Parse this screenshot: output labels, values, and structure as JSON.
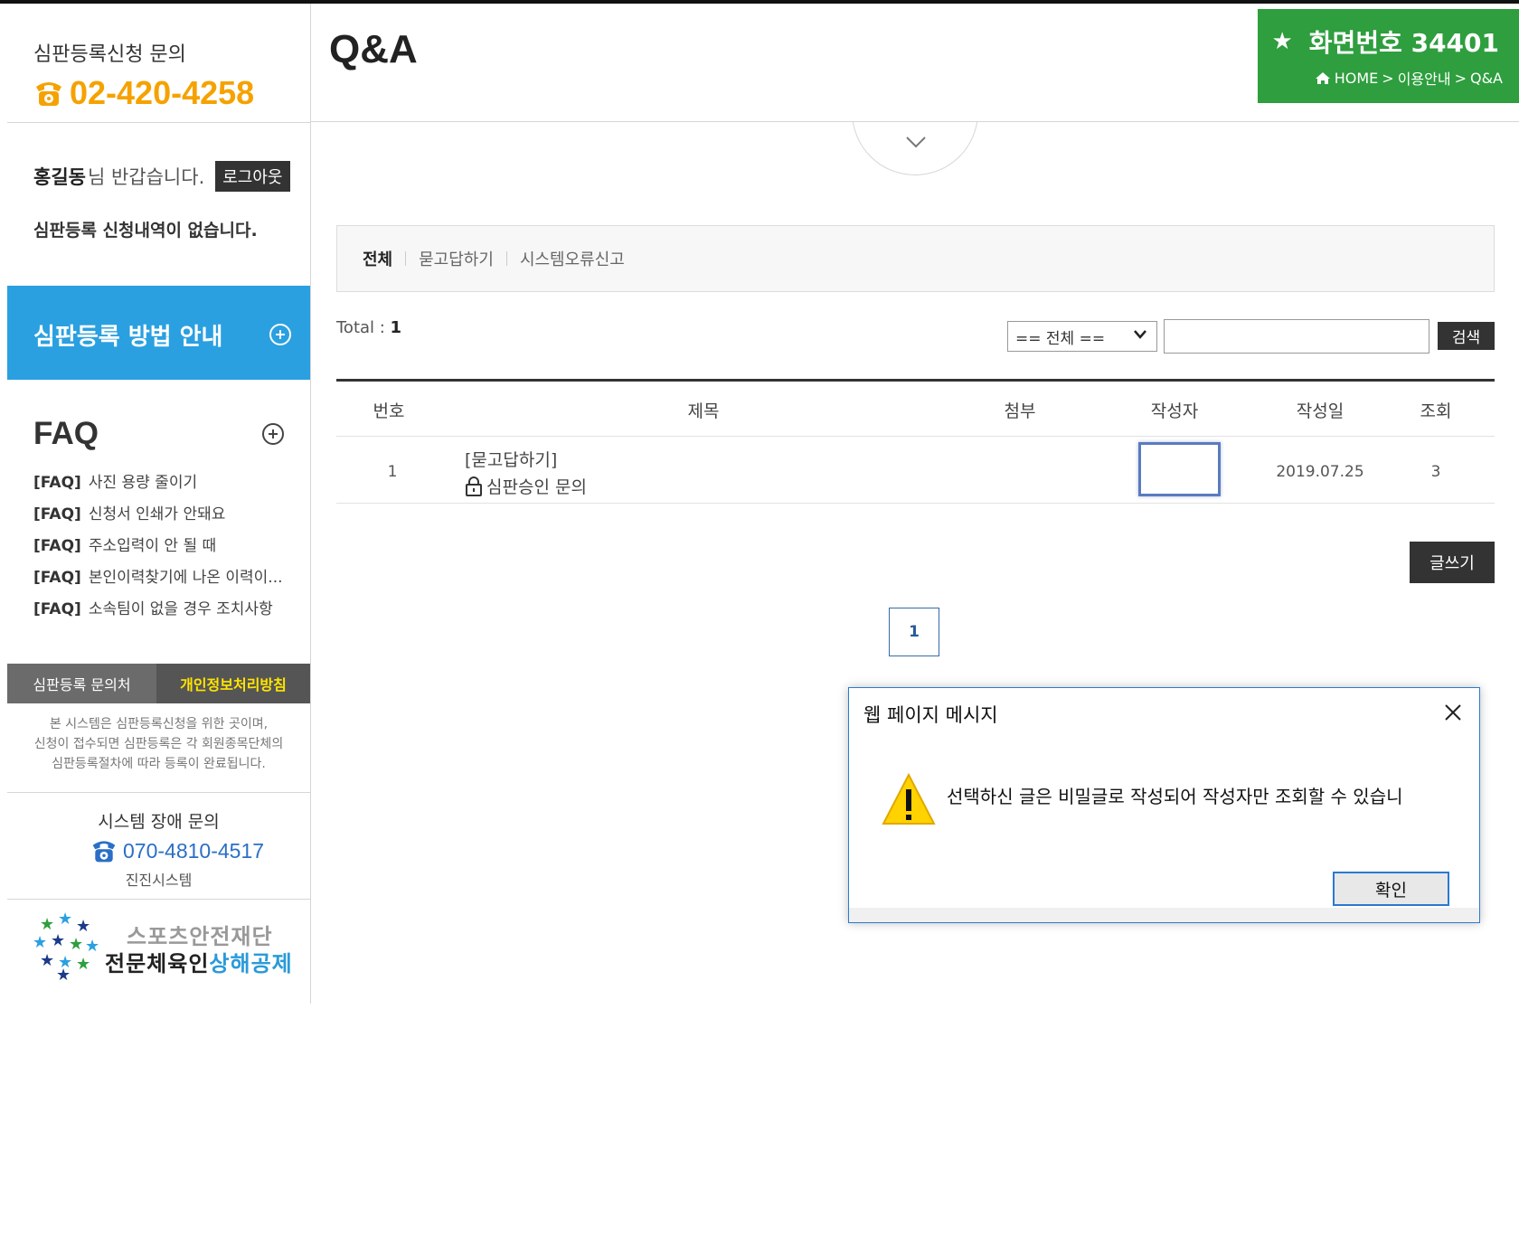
{
  "sidebar": {
    "contact_label": "심판등록신청 문의",
    "contact_phone": "02-420-4258",
    "user_name": "홍길동",
    "greeting_suffix": "님 반갑습니다.",
    "logout_label": "로그아웃",
    "no_history": "심판등록 신청내역이 없습니다.",
    "guide_banner": "심판등록 방법 안내",
    "faq_title": "FAQ",
    "faq_tag": "[FAQ]",
    "faq_items": [
      "사진 용량 줄이기",
      "신청서 인쇄가 안돼요",
      "주소입력이 안 될 때",
      "본인이력찾기에 나온 이력이...",
      "소속팀이 없을 경우 조치사항"
    ],
    "tab_contact": "심판등록 문의처",
    "tab_privacy": "개인정보처리방침",
    "notice_lines": [
      "본 시스템은 심판등록신청을 위한 곳이며,",
      "신청이 접수되면 심판등록은 각 회원종목단체의",
      "심판등록절차에 따라 등록이 완료됩니다."
    ],
    "sys_title": "시스템 장애 문의",
    "sys_phone": "070-4810-4517",
    "sys_company": "진진시스템",
    "logo_line1": "스포츠안전재단",
    "logo_line2_a": "전문체육인",
    "logo_line2_b": "상해공제"
  },
  "header": {
    "page_title": "Q&A",
    "screen_number": "화면번호 34401",
    "breadcrumb": [
      "HOME",
      ">",
      "이용안내",
      ">",
      "Q&A"
    ]
  },
  "categories": [
    "전체",
    "묻고답하기",
    "시스템오류신고"
  ],
  "total_label": "Total : ",
  "total_count": "1",
  "search": {
    "select_value": "== 전체 ==",
    "input_value": "",
    "button_label": "검색"
  },
  "table": {
    "headers": [
      "번호",
      "제목",
      "첨부",
      "작성자",
      "작성일",
      "조회"
    ],
    "rows": [
      {
        "no": "1",
        "category": "[묻고답하기]",
        "title": "심판승인 문의",
        "attachment": "",
        "writer": "",
        "date": "2019.07.25",
        "views": "3"
      }
    ]
  },
  "write_label": "글쓰기",
  "pagination": [
    "1"
  ],
  "dialog": {
    "title": "웹 페이지 메시지",
    "message": "선택하신 글은 비밀글로 작성되어 작성자만 조회할 수 있습니",
    "ok_label": "확인"
  },
  "colors": {
    "orange": "#f5a200",
    "blue_banner": "#2aa0e0",
    "green_box": "#2e9e3e",
    "yellow_tab": "#ffe400",
    "dialog_border": "#2b79d0"
  }
}
